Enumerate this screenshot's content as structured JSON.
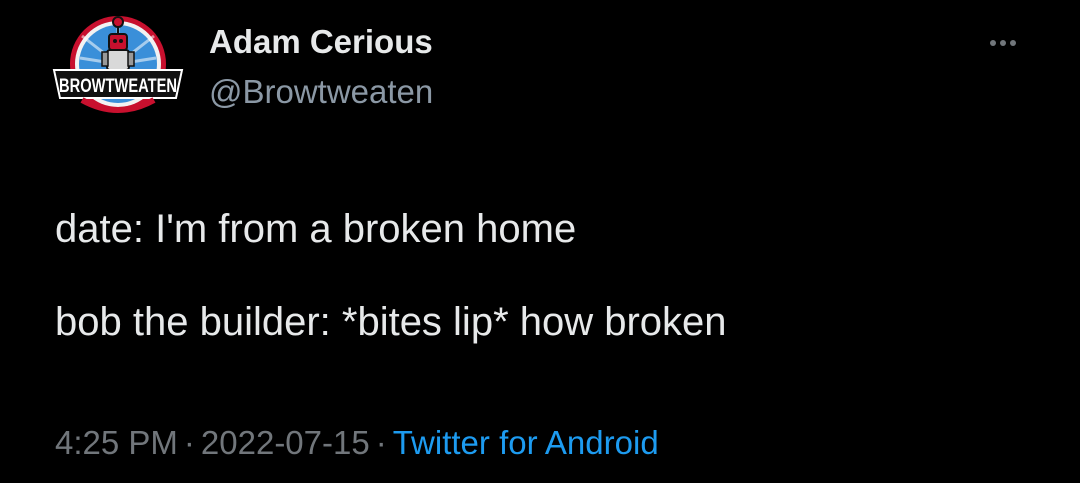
{
  "author": {
    "display_name": "Adam Cerious",
    "handle": "@Browtweaten",
    "avatar_text": "BROWTWEATEN"
  },
  "tweet": {
    "lines": [
      "date: I'm from a broken home",
      "bob the builder: *bites lip* how broken"
    ]
  },
  "meta": {
    "time": "4:25 PM",
    "separator": "·",
    "date": "2022-07-15",
    "source": "Twitter for Android"
  },
  "icons": {
    "more": "more-options-icon"
  },
  "colors": {
    "background": "#000000",
    "primary_text": "#e7e9ea",
    "secondary_text": "#71767b",
    "link": "#1d9bf0"
  }
}
